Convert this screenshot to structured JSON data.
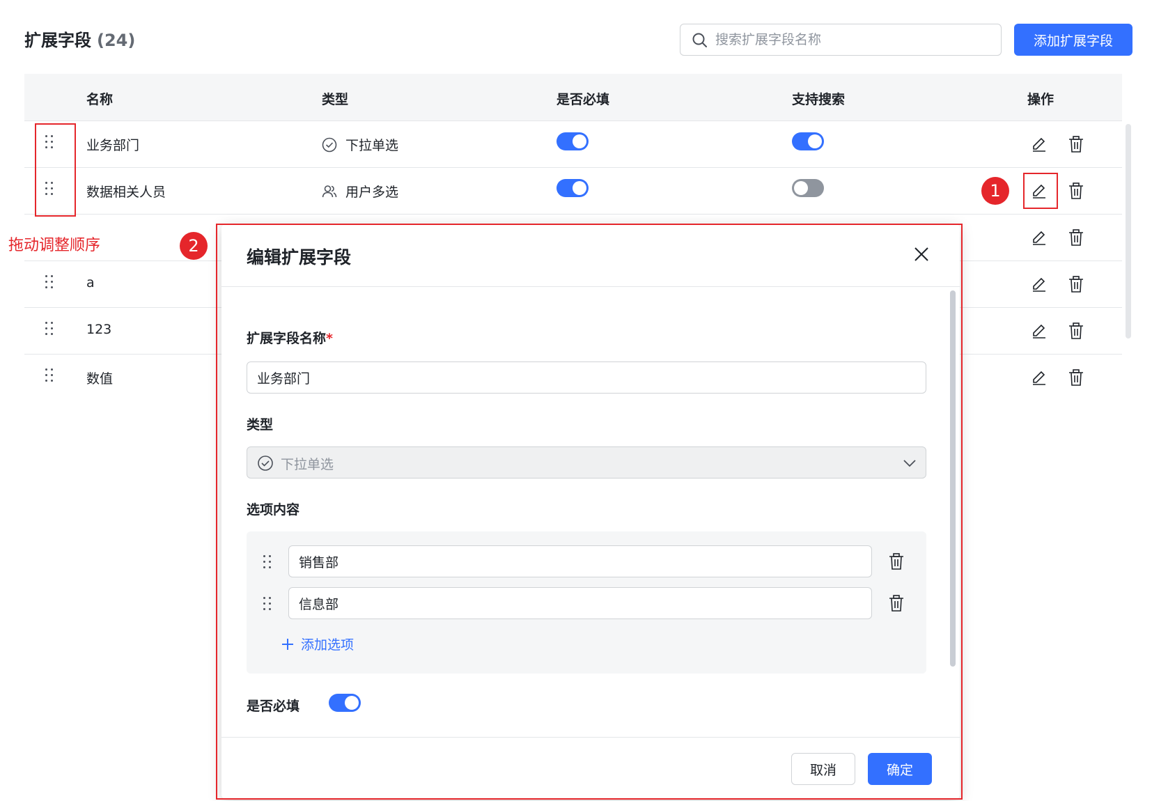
{
  "header": {
    "title": "扩展字段",
    "count": "(24)",
    "search_placeholder": "搜索扩展字段名称",
    "add_button": "添加扩展字段"
  },
  "table": {
    "columns": [
      "名称",
      "类型",
      "是否必填",
      "支持搜索",
      "操作"
    ],
    "rows": [
      {
        "name": "业务部门",
        "type": "下拉单选",
        "type_icon": "check-circle-icon",
        "required": true,
        "searchable": true
      },
      {
        "name": "数据相关人员",
        "type": "用户多选",
        "type_icon": "users-icon",
        "required": true,
        "searchable": false
      },
      {
        "name": "",
        "type": "",
        "required": null,
        "searchable": null
      },
      {
        "name": "a",
        "type": "",
        "required": null,
        "searchable": null
      },
      {
        "name": "123",
        "type": "",
        "required": null,
        "searchable": null
      },
      {
        "name": "数值",
        "type": "",
        "required": null,
        "searchable": null
      }
    ]
  },
  "annotations": {
    "drag_label": "拖动调整顺序",
    "marker_1": "1",
    "marker_2": "2",
    "color": "#e5262b"
  },
  "modal": {
    "title": "编辑扩展字段",
    "name_label": "扩展字段名称",
    "required_mark": "*",
    "name_value": "业务部门",
    "type_label": "类型",
    "type_value": "下拉单选",
    "options_label": "选项内容",
    "options": [
      "销售部",
      "信息部"
    ],
    "add_option": "添加选项",
    "required_label": "是否必填",
    "required_on": true,
    "cancel": "取消",
    "confirm": "确定"
  },
  "colors": {
    "accent": "#3370ff",
    "toggle_off": "#8f959e",
    "annotation_red": "#e5262b"
  }
}
